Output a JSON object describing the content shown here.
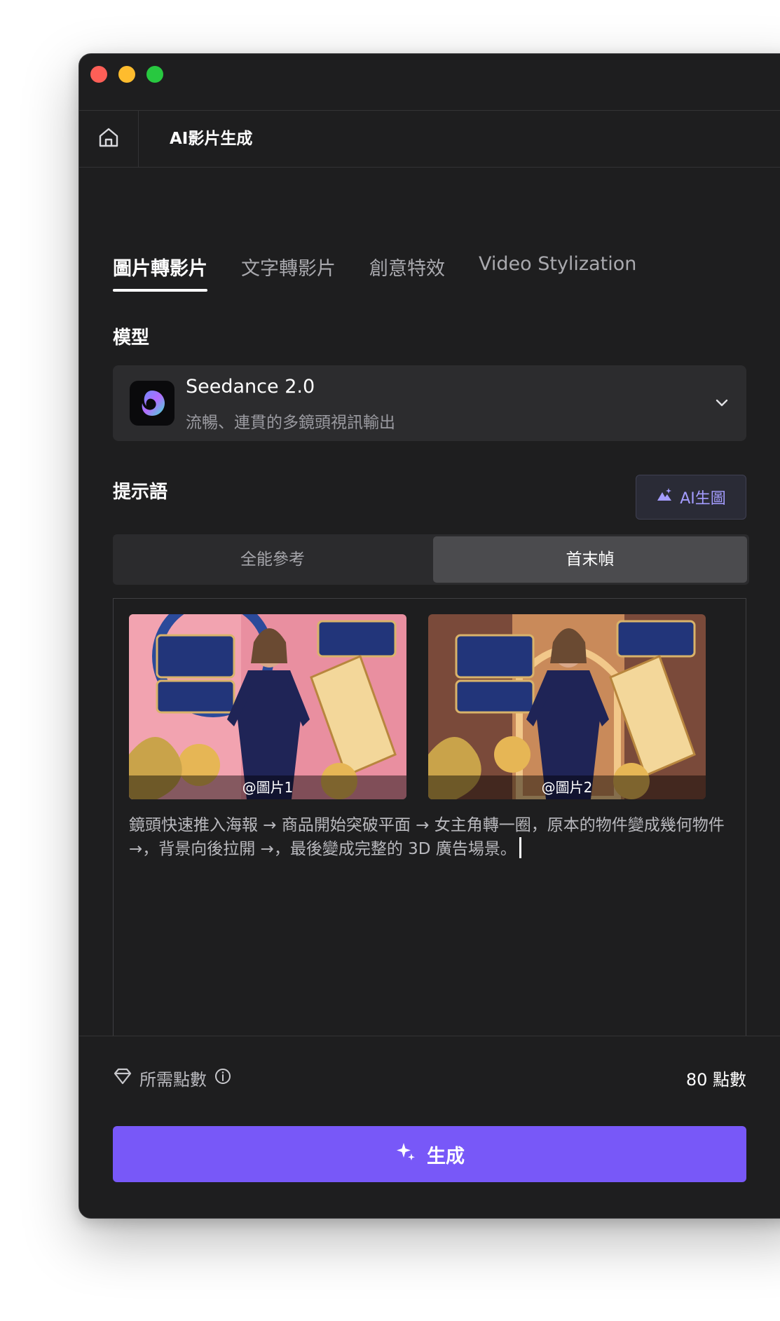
{
  "window": {
    "app_title": "AI影片生成"
  },
  "tabs": [
    {
      "label": "圖片轉影片",
      "active": true
    },
    {
      "label": "文字轉影片",
      "active": false
    },
    {
      "label": "創意特效",
      "active": false
    },
    {
      "label": "Video Stylization",
      "active": false
    }
  ],
  "model": {
    "section_label": "模型",
    "name": "Seedance 2.0",
    "description": "流暢、連貫的多鏡頭視訊輸出"
  },
  "prompt": {
    "section_label": "提示語",
    "ai_image_button": "AI生圖",
    "modes": [
      {
        "label": "全能參考",
        "selected": false
      },
      {
        "label": "首末幀",
        "selected": true
      }
    ],
    "images": [
      {
        "label": "@圖片1"
      },
      {
        "label": "@圖片2"
      }
    ],
    "text": "鏡頭快速推入海報 → 商品開始突破平面 → 女主角轉一圈，原本的物件變成幾何物件 →，背景向後拉開 →，最後變成完整的 3D 廣告場景。"
  },
  "footer": {
    "points_label": "所需點數",
    "points_value": "80 點數",
    "generate_label": "生成"
  },
  "colors": {
    "accent": "#7858f8",
    "window_bg": "#1e1e1f",
    "ai_button_text": "#a49cff"
  },
  "icons": {
    "home": "home-icon",
    "chevron": "chevron-down-icon",
    "ai_image": "ai-image-icon",
    "points": "diamond-icon",
    "info": "info-icon",
    "sparkle": "sparkle-icon"
  }
}
